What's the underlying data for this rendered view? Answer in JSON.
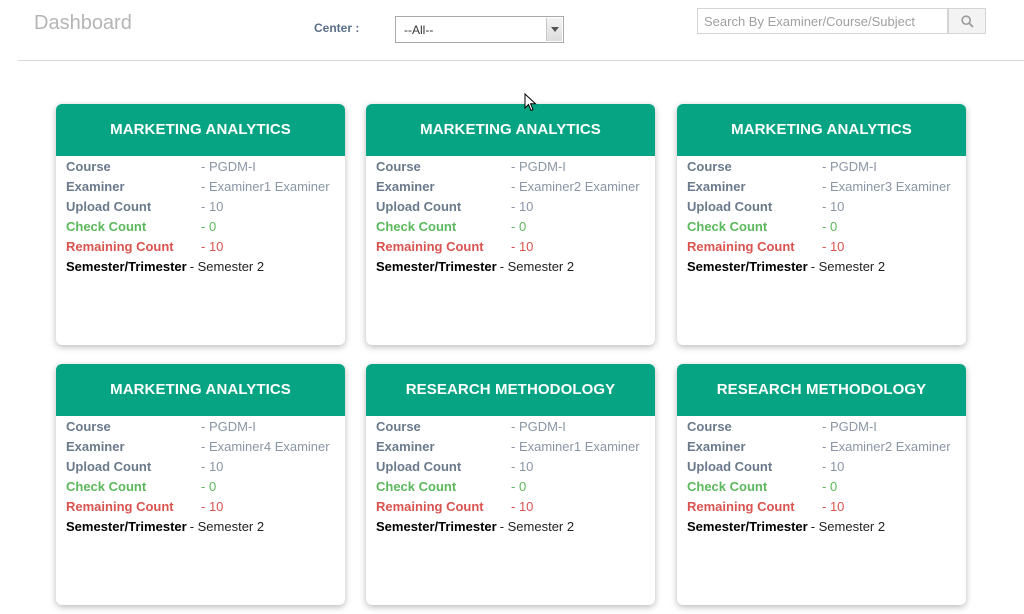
{
  "header": {
    "title": "Dashboard",
    "center_label": "Center :",
    "center_selected": "--All--",
    "search_placeholder": "Search By Examiner/Course/Subject"
  },
  "labels": {
    "course": "Course",
    "examiner": "Examiner",
    "upload": "Upload Count",
    "check": "Check Count",
    "remaining": "Remaining Count",
    "semester": "Semester/Trimester"
  },
  "cards": [
    {
      "title": "MARKETING ANALYTICS",
      "course": "- PGDM-I",
      "examiner": "- Examiner1 Examiner",
      "upload": "- 10",
      "check": "- 0",
      "remaining": "- 10",
      "semester": "- Semester 2"
    },
    {
      "title": "MARKETING ANALYTICS",
      "course": "- PGDM-I",
      "examiner": "- Examiner2 Examiner",
      "upload": "- 10",
      "check": "- 0",
      "remaining": "- 10",
      "semester": "- Semester 2"
    },
    {
      "title": "MARKETING ANALYTICS",
      "course": "- PGDM-I",
      "examiner": "- Examiner3 Examiner",
      "upload": "- 10",
      "check": "- 0",
      "remaining": "- 10",
      "semester": "- Semester 2"
    },
    {
      "title": "MARKETING ANALYTICS",
      "course": "- PGDM-I",
      "examiner": "- Examiner4 Examiner",
      "upload": "- 10",
      "check": "- 0",
      "remaining": "- 10",
      "semester": "- Semester 2"
    },
    {
      "title": "RESEARCH METHODOLOGY",
      "course": "- PGDM-I",
      "examiner": "- Examiner1 Examiner",
      "upload": "- 10",
      "check": "- 0",
      "remaining": "- 10",
      "semester": "- Semester 2"
    },
    {
      "title": "RESEARCH METHODOLOGY",
      "course": "- PGDM-I",
      "examiner": "- Examiner2 Examiner",
      "upload": "- 10",
      "check": "- 0",
      "remaining": "- 10",
      "semester": "- Semester 2"
    }
  ],
  "colors": {
    "card_header": "#06a483",
    "check": "#5cb85c",
    "remaining": "#d9534f"
  },
  "icons": {
    "search": "search-icon",
    "dropdown": "chevron-down-icon",
    "cursor": "mouse-cursor-icon"
  }
}
